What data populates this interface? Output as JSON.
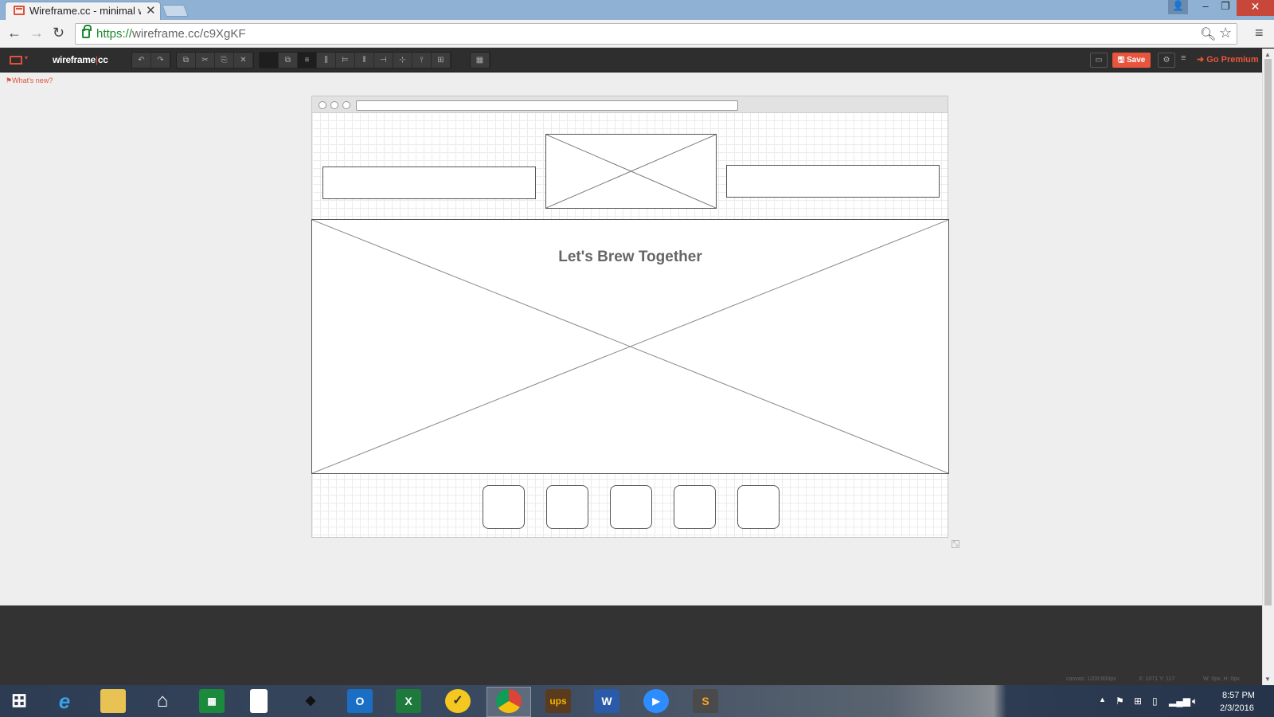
{
  "browser": {
    "tab_title": "Wireframe.cc - minimal wi",
    "tab_close": "✕",
    "url_scheme": "https://",
    "url_rest": "wireframe.cc/c9XgKF",
    "window_buttons": {
      "minimize": "–",
      "restore": "❐",
      "close": "✕"
    }
  },
  "app": {
    "logo_left": "wireframe",
    "logo_sep": "|",
    "logo_right": "cc",
    "whats_new": "What's new?",
    "save_label": "Save",
    "go_premium": "Go Premium",
    "accent_color": "#e8553e"
  },
  "toolbar": {
    "history": [
      "↶",
      "↷"
    ],
    "edit": [
      "⧉",
      "✂",
      "⎘",
      "✕"
    ],
    "arrange": [
      "",
      "⧉",
      "≡",
      "⫼",
      "⊨",
      "⫴",
      "⊣",
      "⊹",
      "⫯",
      "⊞"
    ],
    "grid": "▦"
  },
  "canvas": {
    "hero_title": "Let's Brew Together"
  },
  "status": {
    "canvas_size": "canvas: 1200:800px",
    "coords": "X: 1071 Y: 117",
    "dims": "W: 0px, H: 0px"
  },
  "taskbar": {
    "time": "8:57 PM",
    "date": "2/3/2016",
    "apps": [
      "start",
      "internet-explorer",
      "file-explorer",
      "home",
      "store",
      "file",
      "tool",
      "outlook",
      "excel",
      "norton",
      "chrome",
      "ups",
      "word",
      "zoom",
      "sublime-text"
    ]
  }
}
